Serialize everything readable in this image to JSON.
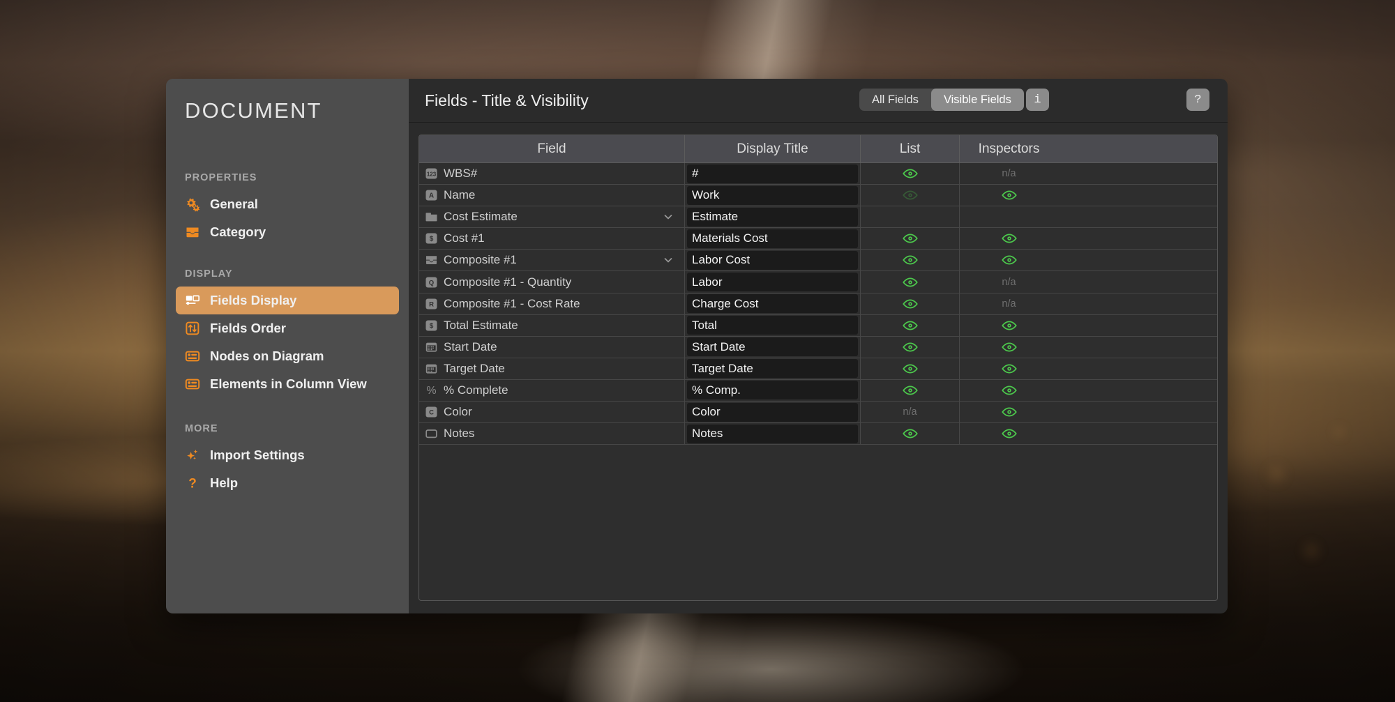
{
  "sidebar": {
    "title": "DOCUMENT",
    "sections": [
      {
        "label": "PROPERTIES",
        "items": [
          {
            "label": "General",
            "icon": "gears-icon",
            "selected": false
          },
          {
            "label": "Category",
            "icon": "category-icon",
            "selected": false
          }
        ]
      },
      {
        "label": "DISPLAY",
        "items": [
          {
            "label": "Fields Display",
            "icon": "fields-display-icon",
            "selected": true
          },
          {
            "label": "Fields Order",
            "icon": "sort-arrows-icon",
            "selected": false
          },
          {
            "label": "Nodes on Diagram",
            "icon": "node-card-icon",
            "selected": false
          },
          {
            "label": "Elements in Column View",
            "icon": "column-view-icon",
            "selected": false
          }
        ]
      },
      {
        "label": "MORE",
        "items": [
          {
            "label": "Import Settings",
            "icon": "sparkle-icon",
            "selected": false
          },
          {
            "label": "Help",
            "icon": "question-icon",
            "selected": false
          }
        ]
      }
    ]
  },
  "header": {
    "title": "Fields - Title & Visibility",
    "segments": [
      {
        "label": "All Fields",
        "active": false
      },
      {
        "label": "Visible Fields",
        "active": true
      }
    ],
    "info_button": "i",
    "help_button": "?"
  },
  "table": {
    "columns": [
      "Field",
      "Display Title",
      "List",
      "Inspectors"
    ],
    "rows": [
      {
        "field": "WBS#",
        "icon": "number-123-icon",
        "indent": 0,
        "chevron": false,
        "display_title": "#",
        "list": "visible",
        "inspectors": "n/a"
      },
      {
        "field": "Name",
        "icon": "text-a-icon",
        "indent": 0,
        "chevron": false,
        "display_title": "Work",
        "list": "dimmed",
        "inspectors": "visible"
      },
      {
        "field": "Cost Estimate",
        "icon": "folder-icon",
        "indent": 0,
        "chevron": true,
        "display_title": "Estimate",
        "list": "none",
        "inspectors": "none"
      },
      {
        "field": "Cost #1",
        "icon": "dollar-icon",
        "indent": 1,
        "chevron": false,
        "display_title": "Materials Cost",
        "list": "visible",
        "inspectors": "visible"
      },
      {
        "field": "Composite #1",
        "icon": "composite-icon",
        "indent": 1,
        "chevron": true,
        "display_title": "Labor Cost",
        "list": "visible",
        "inspectors": "visible"
      },
      {
        "field": "Composite #1 - Quantity",
        "icon": "quantity-q-icon",
        "indent": 2,
        "chevron": false,
        "display_title": "Labor",
        "list": "visible",
        "inspectors": "n/a"
      },
      {
        "field": "Composite #1 - Cost Rate",
        "icon": "rate-r-icon",
        "indent": 2,
        "chevron": false,
        "display_title": "Charge Cost",
        "list": "visible",
        "inspectors": "n/a"
      },
      {
        "field": "Total Estimate",
        "icon": "dollar-icon",
        "indent": 1,
        "chevron": false,
        "display_title": "Total",
        "list": "visible",
        "inspectors": "visible"
      },
      {
        "field": "Start Date",
        "icon": "calendar-icon",
        "indent": 0,
        "chevron": false,
        "display_title": "Start Date",
        "list": "visible",
        "inspectors": "visible"
      },
      {
        "field": "Target Date",
        "icon": "calendar-icon",
        "indent": 0,
        "chevron": false,
        "display_title": "Target Date",
        "list": "visible",
        "inspectors": "visible"
      },
      {
        "field": "% Complete",
        "icon": "percent-icon",
        "indent": 0,
        "chevron": false,
        "display_title": "% Comp.",
        "list": "visible",
        "inspectors": "visible"
      },
      {
        "field": "Color",
        "icon": "color-c-icon",
        "indent": 0,
        "chevron": false,
        "display_title": "Color",
        "list": "n/a",
        "inspectors": "visible"
      },
      {
        "field": "Notes",
        "icon": "notes-icon",
        "indent": 0,
        "chevron": false,
        "display_title": "Notes",
        "list": "visible",
        "inspectors": "visible"
      }
    ],
    "na_label": "n/a"
  },
  "colors": {
    "accent": "#d99a5b",
    "sidebar_bg": "#4d4d4d",
    "panel_bg": "#2b2b2b",
    "eye_green": "#4cc84c",
    "field_icon_gray": "#8a8a8a"
  }
}
